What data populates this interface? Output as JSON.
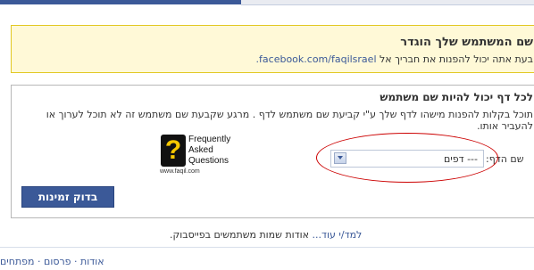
{
  "notice": {
    "title": "שם המשתמש שלך הוגדר",
    "text_prefix": "בעת אתה יכול להפנות את חבריך אל",
    "url": "facebook.com/faqilsrael."
  },
  "panel": {
    "title": "לכל דף יכול להיות שם משתמש",
    "description": "תוכל בקלות להפנות מישהו לדף שלך ע\"י קביעת שם משתמש לדף . מרגע שקבעת שם משתמש זה לא תוכל לערוך או להעביר אותו.",
    "logo": {
      "glyph": "?",
      "line1": "Frequently",
      "line2": "Asked",
      "line3": "Questions",
      "url": "www.faqil.com"
    },
    "field_label": "שם הדף:",
    "select_value": "--- דפים",
    "check_button": "בדוק זמינות"
  },
  "learn_more": {
    "link": "למד/י עוד...",
    "text": "אודות שמות משתמשים בפייסבוק."
  },
  "footer": {
    "links": [
      "אודות",
      "פרסום",
      "מפתחים"
    ]
  },
  "colors": {
    "brand": "#3b5998",
    "notice_bg": "#fff9d7",
    "notice_border": "#e2c822",
    "highlight_oval": "#cc0000"
  }
}
